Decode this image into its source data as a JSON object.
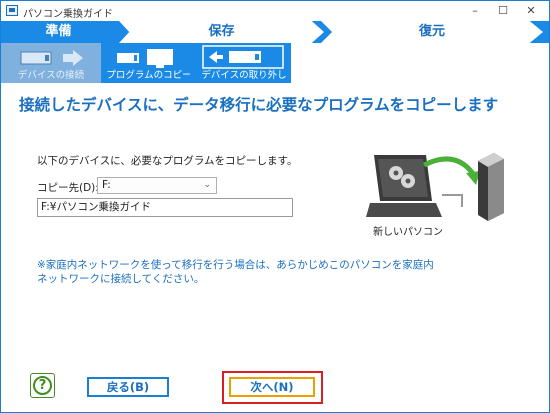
{
  "window": {
    "title": "パソコン乗換ガイド",
    "controls": {
      "minimize": "–",
      "maximize": "☐",
      "close": "✕"
    }
  },
  "steps": {
    "items": [
      {
        "label": "準備",
        "state": "active"
      },
      {
        "label": "保存",
        "state": "upcoming"
      },
      {
        "label": "復元",
        "state": "upcoming"
      }
    ]
  },
  "substeps": {
    "items": [
      {
        "label": "デバイスの接続",
        "state": "done"
      },
      {
        "label": "プログラムのコピー",
        "state": "active"
      },
      {
        "label": "デバイスの取り外し",
        "state": "upcoming"
      }
    ]
  },
  "main": {
    "heading": "接続したデバイスに、データ移行に必要なプログラムをコピーします",
    "instruction": "以下のデバイスに、必要なプログラムをコピーします。",
    "destination": {
      "label": "コピー先(D):",
      "value": "F:"
    },
    "path": "F:¥パソコン乗換ガイド",
    "illustration_caption": "新しいパソコン",
    "note_line1": "※家庭内ネットワークを使って移行を行う場合は、あらかじめこのパソコンを家庭内",
    "note_line2": "ネットワークに接続してください。"
  },
  "footer": {
    "help": "?",
    "back": "戻る(B)",
    "next": "次へ(N)"
  },
  "colors": {
    "accent": "#1a8ae6",
    "text_blue": "#1a6fc0",
    "highlight_red": "#d91f1f",
    "highlight_orange": "#e8a100",
    "help_green": "#3f8f1f"
  }
}
